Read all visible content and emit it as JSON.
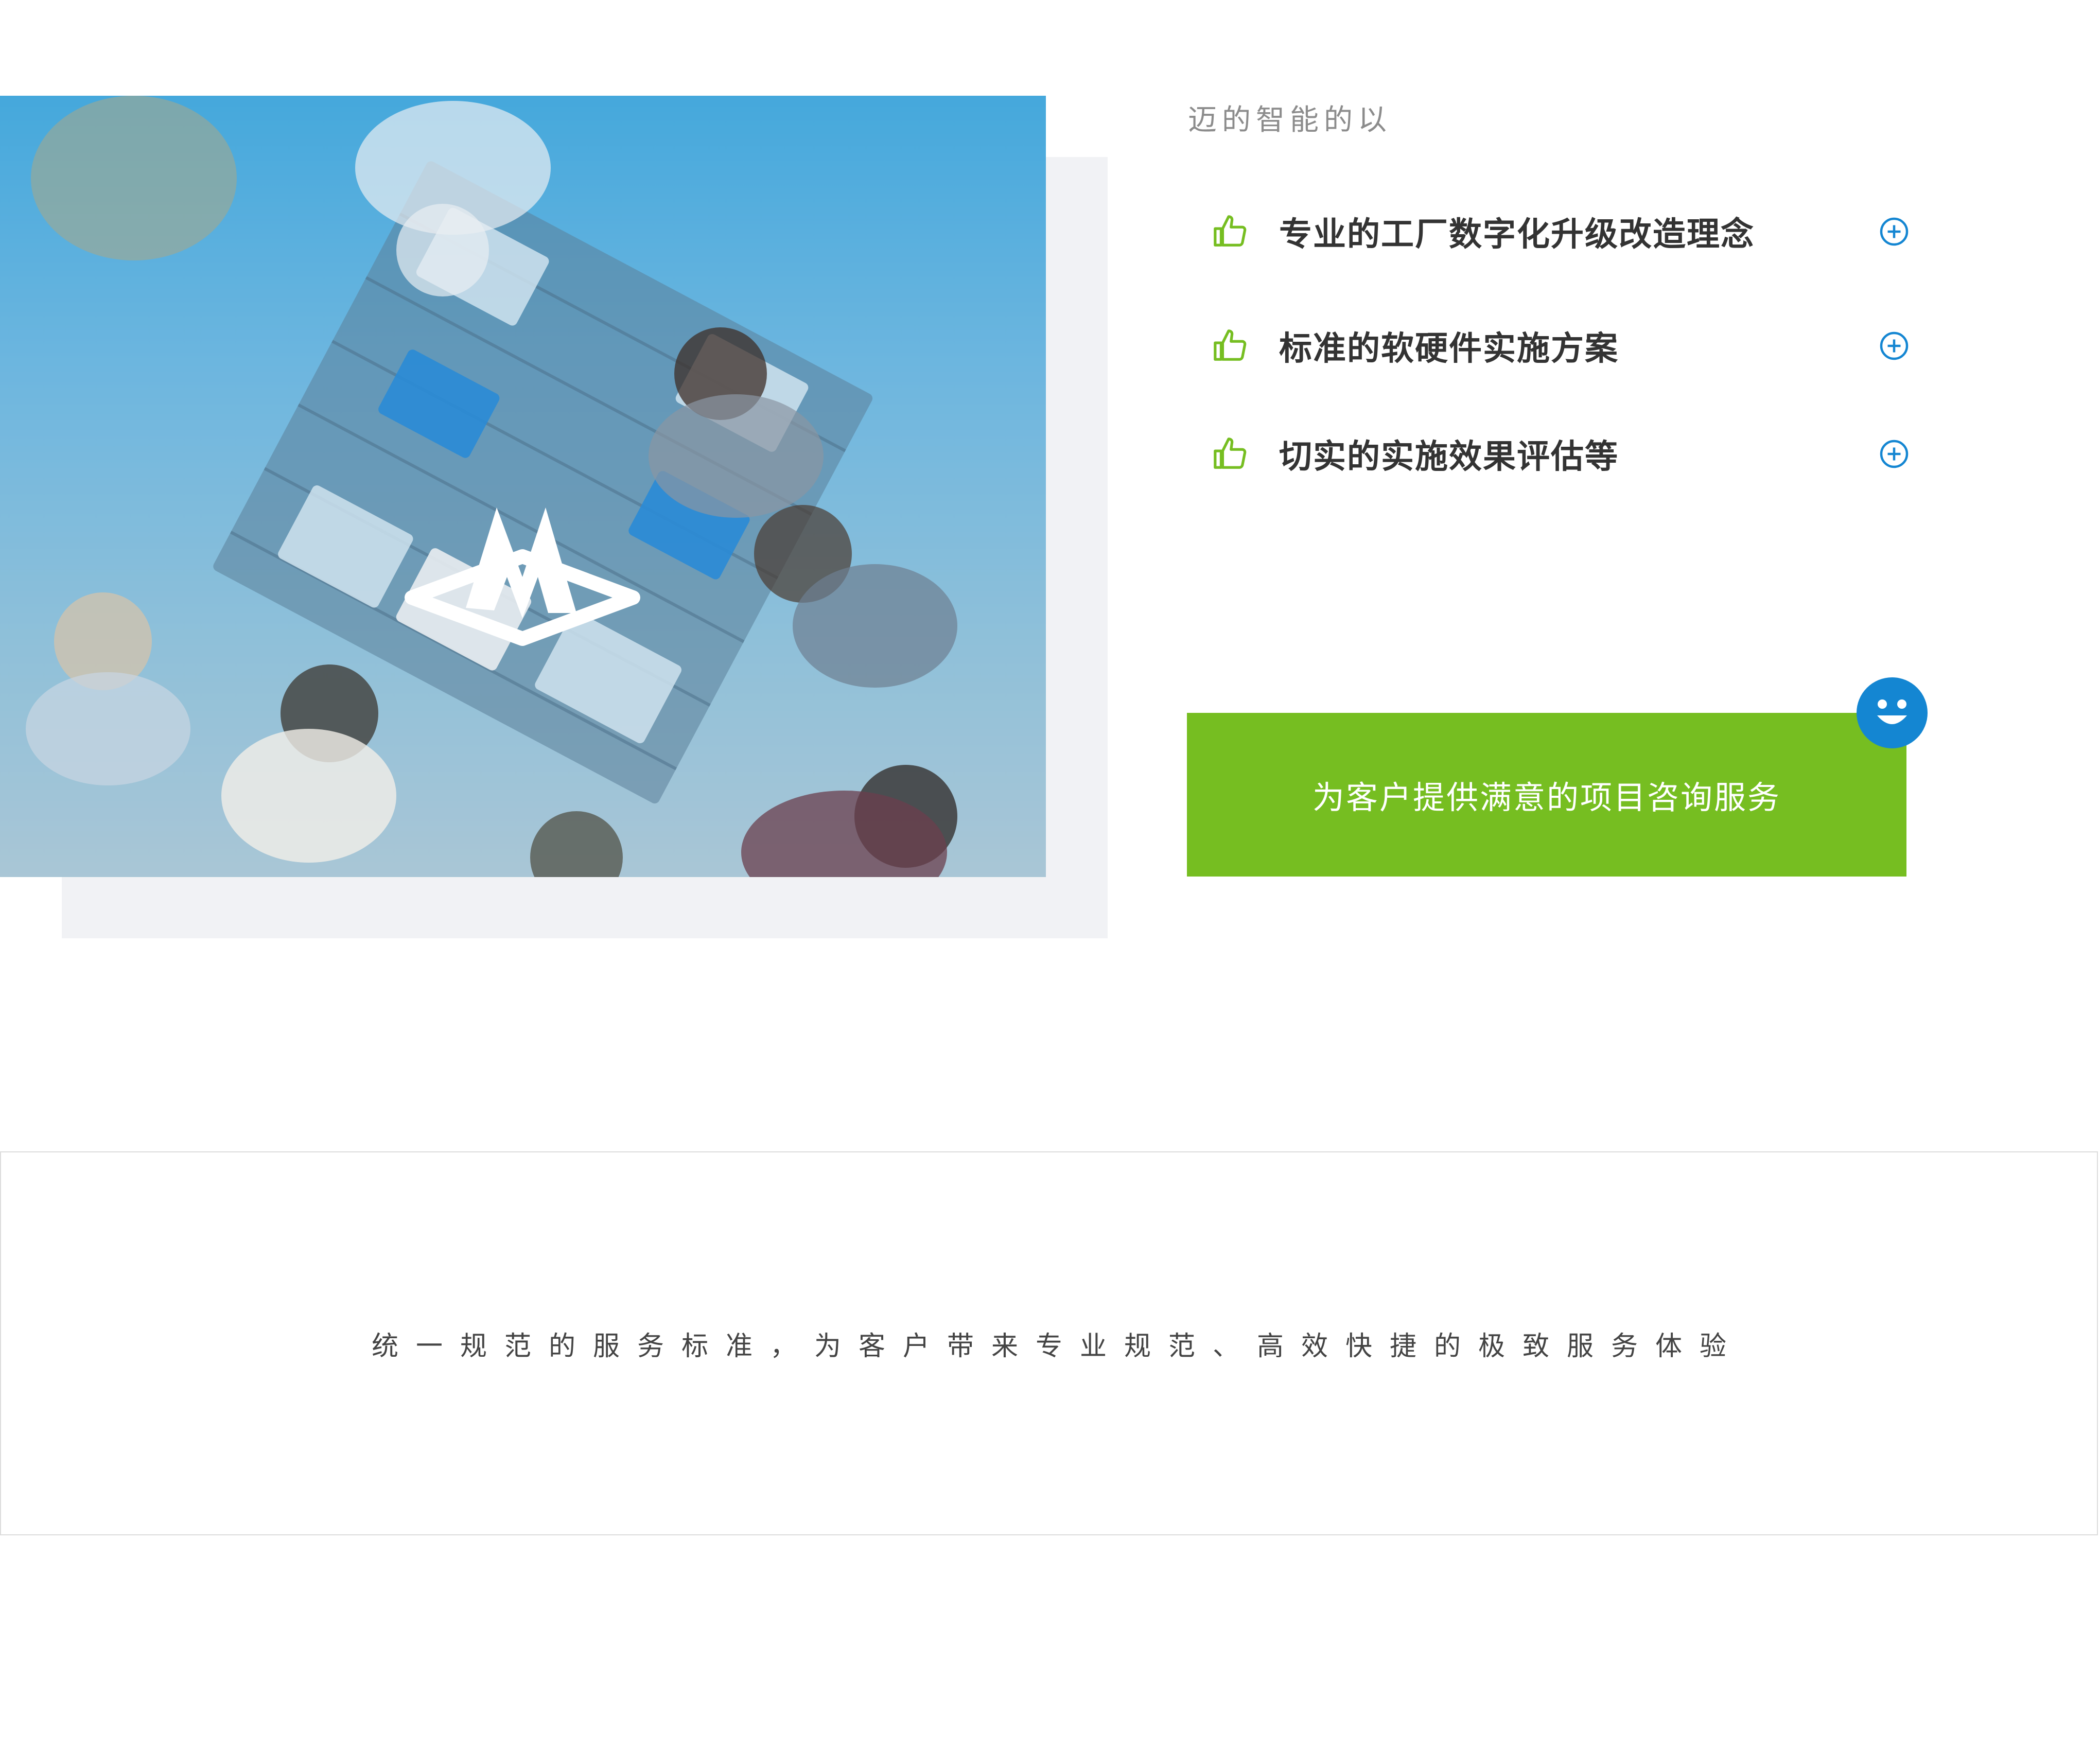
{
  "intro": {
    "text": "迈的智能的以"
  },
  "features": [
    {
      "label": "专业的工厂数字化升级改造理念",
      "icon": "thumbs-up-icon",
      "action_icon": "plus-circle-icon"
    },
    {
      "label": "标准的软硬件实施方案",
      "icon": "thumbs-up-icon",
      "action_icon": "plus-circle-icon"
    },
    {
      "label": "切实的实施效果评估等",
      "icon": "thumbs-up-icon",
      "action_icon": "plus-circle-icon"
    }
  ],
  "cta": {
    "label": "为客户提供满意的项目咨询服务",
    "badge_icon": "smiley-icon"
  },
  "slogan": {
    "text": "统一规范的服务标准，为客户带来专业规范、高效快捷的极致服务体验"
  },
  "colors": {
    "accent_green": "#76be21",
    "accent_blue": "#1486d2",
    "photo_tint": "#45a8dc",
    "backdrop": "#f1f2f5"
  }
}
